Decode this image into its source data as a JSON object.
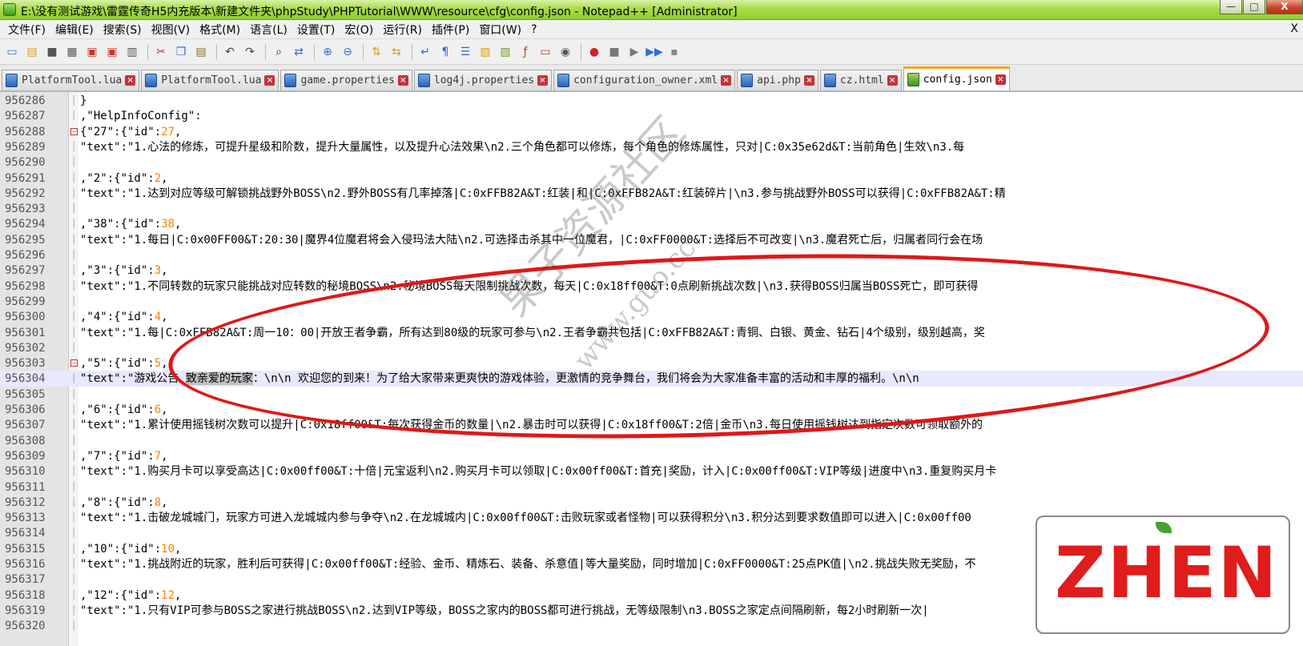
{
  "window": {
    "title": "E:\\没有测试游戏\\雷霆传奇H5内充版本\\新建文件夹\\phpStudy\\PHPTutorial\\WWW\\resource\\cfg\\config.json - Notepad++ [Administrator]",
    "minimize": "—",
    "maximize": "□",
    "close": "X"
  },
  "menu": {
    "items": [
      "文件(F)",
      "编辑(E)",
      "搜索(S)",
      "视图(V)",
      "格式(M)",
      "语言(L)",
      "设置(T)",
      "宏(O)",
      "运行(R)",
      "插件(P)",
      "窗口(W)",
      "?"
    ],
    "close": "X"
  },
  "toolbar": {
    "buttons": [
      {
        "name": "new-file-icon",
        "glyph": "▭",
        "color": "#2f6fd6"
      },
      {
        "name": "open-file-icon",
        "glyph": "▤",
        "color": "#d8a21a"
      },
      {
        "name": "save-icon",
        "glyph": "■",
        "color": "#555555"
      },
      {
        "name": "save-all-icon",
        "glyph": "▦",
        "color": "#555555"
      },
      {
        "name": "close-file-icon",
        "glyph": "▣",
        "color": "#c33a2c"
      },
      {
        "name": "close-all-icon",
        "glyph": "▣",
        "color": "#c33a2c"
      },
      {
        "name": "print-icon",
        "glyph": "▥",
        "color": "#555555"
      },
      {
        "name": "sep"
      },
      {
        "name": "cut-icon",
        "glyph": "✂",
        "color": "#c33a2c"
      },
      {
        "name": "copy-icon",
        "glyph": "❐",
        "color": "#2f6fd6"
      },
      {
        "name": "paste-icon",
        "glyph": "▤",
        "color": "#8a6a2a"
      },
      {
        "name": "sep"
      },
      {
        "name": "undo-icon",
        "glyph": "↶",
        "color": "#444444"
      },
      {
        "name": "redo-icon",
        "glyph": "↷",
        "color": "#444444"
      },
      {
        "name": "sep"
      },
      {
        "name": "find-icon",
        "glyph": "⌕",
        "color": "#333333"
      },
      {
        "name": "replace-icon",
        "glyph": "⇄",
        "color": "#2f6fd6"
      },
      {
        "name": "sep"
      },
      {
        "name": "zoom-in-icon",
        "glyph": "⊕",
        "color": "#2f6fd6"
      },
      {
        "name": "zoom-out-icon",
        "glyph": "⊖",
        "color": "#2f6fd6"
      },
      {
        "name": "sep"
      },
      {
        "name": "sync-vertical-icon",
        "glyph": "⇅",
        "color": "#d8a21a"
      },
      {
        "name": "sync-horizontal-icon",
        "glyph": "⇆",
        "color": "#d8a21a"
      },
      {
        "name": "sep"
      },
      {
        "name": "word-wrap-icon",
        "glyph": "↵",
        "color": "#2f6fd6"
      },
      {
        "name": "show-all-chars-icon",
        "glyph": "¶",
        "color": "#2f6fd6"
      },
      {
        "name": "indent-guide-icon",
        "glyph": "☰",
        "color": "#2f6fd6"
      },
      {
        "name": "user-language-icon",
        "glyph": "▧",
        "color": "#d8a21a"
      },
      {
        "name": "doc-map-icon",
        "glyph": "▨",
        "color": "#7a9a2a"
      },
      {
        "name": "function-list-icon",
        "glyph": "ƒ",
        "color": "#c33a2c"
      },
      {
        "name": "folder-workspace-icon",
        "glyph": "▭",
        "color": "#c33a2c"
      },
      {
        "name": "monitor-icon",
        "glyph": "◉",
        "color": "#555555"
      },
      {
        "name": "sep"
      },
      {
        "name": "record-macro-icon",
        "glyph": "●",
        "color": "#d42020"
      },
      {
        "name": "stop-macro-icon",
        "glyph": "■",
        "color": "#777777"
      },
      {
        "name": "play-macro-icon",
        "glyph": "▶",
        "color": "#777777"
      },
      {
        "name": "run-macro-multiple-icon",
        "glyph": "▶▶",
        "color": "#2f6fd6"
      },
      {
        "name": "save-macro-icon",
        "glyph": "▪",
        "color": "#888888"
      }
    ]
  },
  "tabs": [
    {
      "label": "PlatformTool.lua",
      "active": false
    },
    {
      "label": "PlatformTool.lua",
      "active": false
    },
    {
      "label": "game.properties",
      "active": false
    },
    {
      "label": "log4j.properties",
      "active": false
    },
    {
      "label": "configuration_owner.xml",
      "active": false
    },
    {
      "label": "api.php",
      "active": false
    },
    {
      "label": "cz.html",
      "active": false
    },
    {
      "label": "config.json",
      "active": true
    }
  ],
  "lines": [
    {
      "n": "956286",
      "fold": "line",
      "pre": "}",
      "num": "",
      "post": ""
    },
    {
      "n": "956287",
      "fold": "line",
      "pre": ",\"HelpInfoConfig\":",
      "num": "",
      "post": ""
    },
    {
      "n": "956288",
      "fold": "box",
      "pre": "{\"27\":{\"id\":",
      "num": "27",
      "post": ","
    },
    {
      "n": "956289",
      "fold": "line",
      "pre": "\"text\":\"1.心法的修炼，可提升星级和阶数，提升大量属性，以及提升心法效果\\n2.三个角色都可以修炼，每个角色的修炼属性，只对|C:0x35e62d&T:当前角色|生效\\n3.每",
      "num": "",
      "post": ""
    },
    {
      "n": "956290",
      "fold": "line",
      "pre": "",
      "num": "",
      "post": ""
    },
    {
      "n": "956291",
      "fold": "line",
      "pre": ",\"2\":{\"id\":",
      "num": "2",
      "post": ","
    },
    {
      "n": "956292",
      "fold": "line",
      "pre": "\"text\":\"1.达到对应等级可解锁挑战野外BOSS\\n2.野外BOSS有几率掉落|C:0xFFB82A&T:红装|和|C:0xFFB82A&T:红装碎片|\\n3.参与挑战野外BOSS可以获得|C:0xFFB82A&T:精",
      "num": "",
      "post": ""
    },
    {
      "n": "956293",
      "fold": "line",
      "pre": "",
      "num": "",
      "post": ""
    },
    {
      "n": "956294",
      "fold": "line",
      "pre": ",\"38\":{\"id\":",
      "num": "38",
      "post": ","
    },
    {
      "n": "956295",
      "fold": "line",
      "pre": "\"text\":\"1.每日|C:0x00FF00&T:20:30|魔界4位魔君将会入侵玛法大陆\\n2.可选择击杀其中一位魔君，|C:0xFF0000&T:选择后不可改变|\\n3.魔君死亡后，归属者同行会在场",
      "num": "",
      "post": ""
    },
    {
      "n": "956296",
      "fold": "line",
      "pre": "",
      "num": "",
      "post": ""
    },
    {
      "n": "956297",
      "fold": "line",
      "pre": ",\"3\":{\"id\":",
      "num": "3",
      "post": ","
    },
    {
      "n": "956298",
      "fold": "line",
      "pre": "\"text\":\"1.不同转数的玩家只能挑战对应转数的秘境BOSS\\n2.秘境BOSS每天限制挑战次数，每天|C:0x18ff00&T:0点刷新挑战次数|\\n3.获得BOSS归属当BOSS死亡，即可获得",
      "num": "",
      "post": ""
    },
    {
      "n": "956299",
      "fold": "line",
      "pre": "",
      "num": "",
      "post": ""
    },
    {
      "n": "956300",
      "fold": "line",
      "pre": ",\"4\":{\"id\":",
      "num": "4",
      "post": ","
    },
    {
      "n": "956301",
      "fold": "line",
      "pre": "\"text\":\"1.每|C:0xFFB82A&T:周一10：00|开放王者争霸，所有达到80级的玩家可参与\\n2.王者争霸共包括|C:0xFFB82A&T:青铜、白银、黄金、钻石|4个级别，级别越高，奖",
      "num": "",
      "post": ""
    },
    {
      "n": "956302",
      "fold": "line",
      "pre": "",
      "num": "",
      "post": ""
    },
    {
      "n": "956303",
      "fold": "box",
      "pre": ",\"5\":{\"id\":",
      "num": "5",
      "post": ","
    },
    {
      "n": "956304",
      "fold": "line",
      "pre": "\"text\":\"游戏公告 ",
      "sel": "致亲爱的玩家",
      "post2": "：\\n\\n    欢迎您的到来！为了给大家带来更爽快的游戏体验，更激情的竞争舞台，我们将会为大家准备丰富的活动和丰厚的福利。\\n\\n",
      "num": "",
      "post": "",
      "current": true
    },
    {
      "n": "956305",
      "fold": "line",
      "pre": "",
      "num": "",
      "post": ""
    },
    {
      "n": "956306",
      "fold": "line",
      "pre": ",\"6\":{\"id\":",
      "num": "6",
      "post": ","
    },
    {
      "n": "956307",
      "fold": "line",
      "pre": "\"text\":\"1.累计使用摇钱树次数可以提升|C:0x18ff00&T:每次获得金币的数量|\\n2.暴击时可以获得|C:0x18ff00&T:2倍|金币\\n3.每日使用摇钱树达到指定次数可领取额外的",
      "num": "",
      "post": ""
    },
    {
      "n": "956308",
      "fold": "line",
      "pre": "",
      "num": "",
      "post": ""
    },
    {
      "n": "956309",
      "fold": "line",
      "pre": ",\"7\":{\"id\":",
      "num": "7",
      "post": ","
    },
    {
      "n": "956310",
      "fold": "line",
      "pre": "\"text\":\"1.购买月卡可以享受高达|C:0x00ff00&T:十倍|元宝返利\\n2.购买月卡可以领取|C:0x00ff00&T:首充|奖励，计入|C:0x00ff00&T:VIP等级|进度中\\n3.重复购买月卡",
      "num": "",
      "post": ""
    },
    {
      "n": "956311",
      "fold": "line",
      "pre": "",
      "num": "",
      "post": ""
    },
    {
      "n": "956312",
      "fold": "line",
      "pre": ",\"8\":{\"id\":",
      "num": "8",
      "post": ","
    },
    {
      "n": "956313",
      "fold": "line",
      "pre": "\"text\":\"1.击破龙城城门，玩家方可进入龙城城内参与争夺\\n2.在龙城城内|C:0x00ff00&T:击败玩家或者怪物|可以获得积分\\n3.积分达到要求数值即可以进入|C:0x00ff00",
      "num": "",
      "post": ""
    },
    {
      "n": "956314",
      "fold": "line",
      "pre": "",
      "num": "",
      "post": ""
    },
    {
      "n": "956315",
      "fold": "line",
      "pre": ",\"10\":{\"id\":",
      "num": "10",
      "post": ","
    },
    {
      "n": "956316",
      "fold": "line",
      "pre": "\"text\":\"1.挑战附近的玩家，胜利后可获得|C:0x00ff00&T:经验、金币、精炼石、装备、杀意值|等大量奖励，同时增加|C:0xFF0000&T:25点PK值|\\n2.挑战失败无奖励，不",
      "num": "",
      "post": ""
    },
    {
      "n": "956317",
      "fold": "line",
      "pre": "",
      "num": "",
      "post": ""
    },
    {
      "n": "956318",
      "fold": "line",
      "pre": ",\"12\":{\"id\":",
      "num": "12",
      "post": ","
    },
    {
      "n": "956319",
      "fold": "line",
      "pre": "\"text\":\"1.只有VIP可参与BOSS之家进行挑战BOSS\\n2.达到VIP等级，BOSS之家内的BOSS都可进行挑战，无等级限制\\n3.BOSS之家定点间隔刷新，每2小时刷新一次|",
      "num": "",
      "post": ""
    },
    {
      "n": "956320",
      "fold": "line",
      "pre": "",
      "num": "",
      "post": ""
    }
  ],
  "overlay": {
    "watermark": "果子资源社区",
    "watermark_url": "www.guo.cc",
    "logo": "ZHEN"
  }
}
